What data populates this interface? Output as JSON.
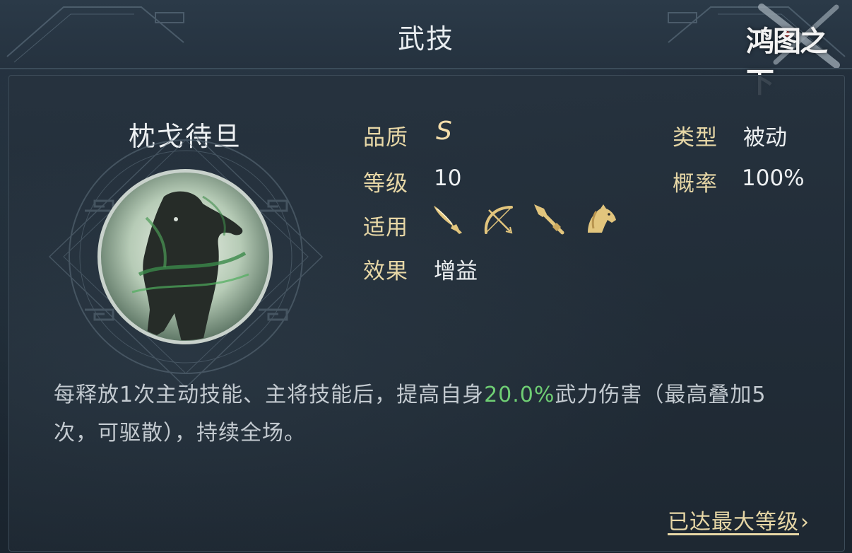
{
  "header": {
    "title": "武技",
    "logo_text": "鸿图之下"
  },
  "skill": {
    "name": "枕戈待旦",
    "stats": {
      "quality_label": "品质",
      "quality_value": "S",
      "level_label": "等级",
      "level_value": "10",
      "applicable_label": "适用",
      "effect_label": "效果",
      "effect_value": "增益",
      "type_label": "类型",
      "type_value": "被动",
      "chance_label": "概率",
      "chance_value": "100%"
    },
    "applicable_icons": [
      "sword-icon",
      "bow-icon",
      "spear-icon",
      "horse-icon"
    ],
    "description": {
      "part1": "每释放1次主动技能、主将技能后，提高自身",
      "highlight": "20.0%",
      "part2": "武力伤害（最高叠加5次，可驱散），持续全场。"
    },
    "max_level_link": "已达最大等级",
    "max_level_chevron": "›"
  },
  "colors": {
    "label_gold": "#e7d7a6",
    "highlight_green": "#6fce74",
    "text_white": "#edf0f2",
    "background": "#1e2a35"
  }
}
